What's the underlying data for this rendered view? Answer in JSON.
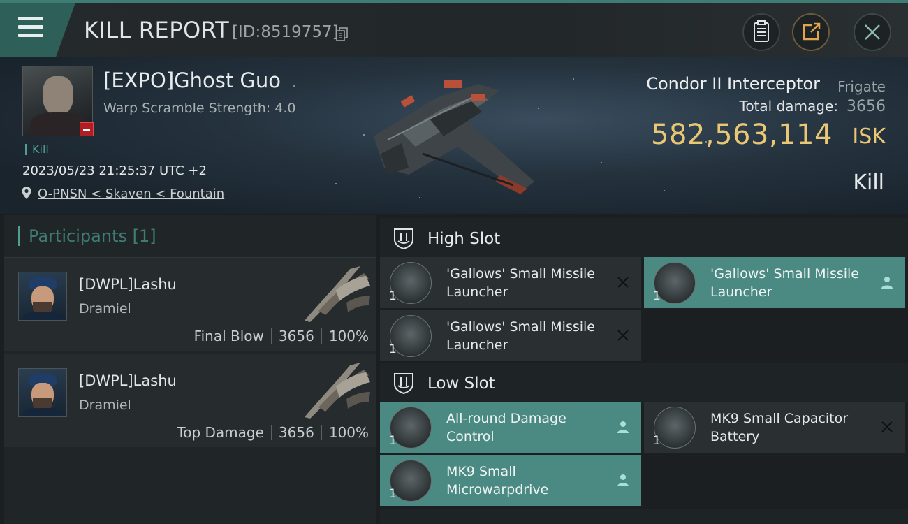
{
  "header": {
    "title": "KILL REPORT",
    "id_text": "[ID:8519757]",
    "icons": {
      "menu": "hamburger-icon",
      "copy": "copy-icon",
      "report": "clipboard-icon",
      "share": "share-icon",
      "close": "close-icon"
    }
  },
  "victim": {
    "name": "[EXPO]Ghost Guo",
    "warp_scramble": "Warp Scramble Strength: 4.0",
    "tag": "Kill",
    "datetime": "2023/05/23 21:25:37 UTC +2",
    "location": "O-PNSN < Skaven < Fountain",
    "ship_name": "Condor II Interceptor",
    "ship_class": "Frigate",
    "total_damage_label": "Total damage:",
    "total_damage_value": "3656",
    "isk_value": "582,563,114",
    "isk_unit": "ISK",
    "result": "Kill"
  },
  "participants": {
    "header": "Participants [1]",
    "items": [
      {
        "name": "[DWPL]Lashu",
        "ship": "Dramiel",
        "role": "Final Blow",
        "damage": "3656",
        "percent": "100%"
      },
      {
        "name": "[DWPL]Lashu",
        "ship": "Dramiel",
        "role": "Top Damage",
        "damage": "3656",
        "percent": "100%"
      }
    ]
  },
  "fitting": {
    "high_slot": {
      "title": "High Slot",
      "modules": [
        {
          "name": "'Gallows' Small Missile Launcher",
          "qty": "1",
          "status": "destroyed"
        },
        {
          "name": "'Gallows' Small Missile Launcher",
          "qty": "1",
          "status": "dropped"
        },
        {
          "name": "'Gallows' Small Missile Launcher",
          "qty": "1",
          "status": "destroyed"
        }
      ]
    },
    "low_slot": {
      "title": "Low Slot",
      "modules": [
        {
          "name": "All-round Damage Control",
          "qty": "1",
          "status": "dropped"
        },
        {
          "name": "MK9 Small Capacitor Battery",
          "qty": "1",
          "status": "destroyed"
        },
        {
          "name": "MK9 Small Microwarpdrive",
          "qty": "1",
          "status": "dropped"
        }
      ]
    }
  },
  "colors": {
    "accent": "#4e9f90",
    "dropped_bg": "#4b8a82",
    "isk": "#e9c774",
    "corp_badge": "#b01e24"
  }
}
